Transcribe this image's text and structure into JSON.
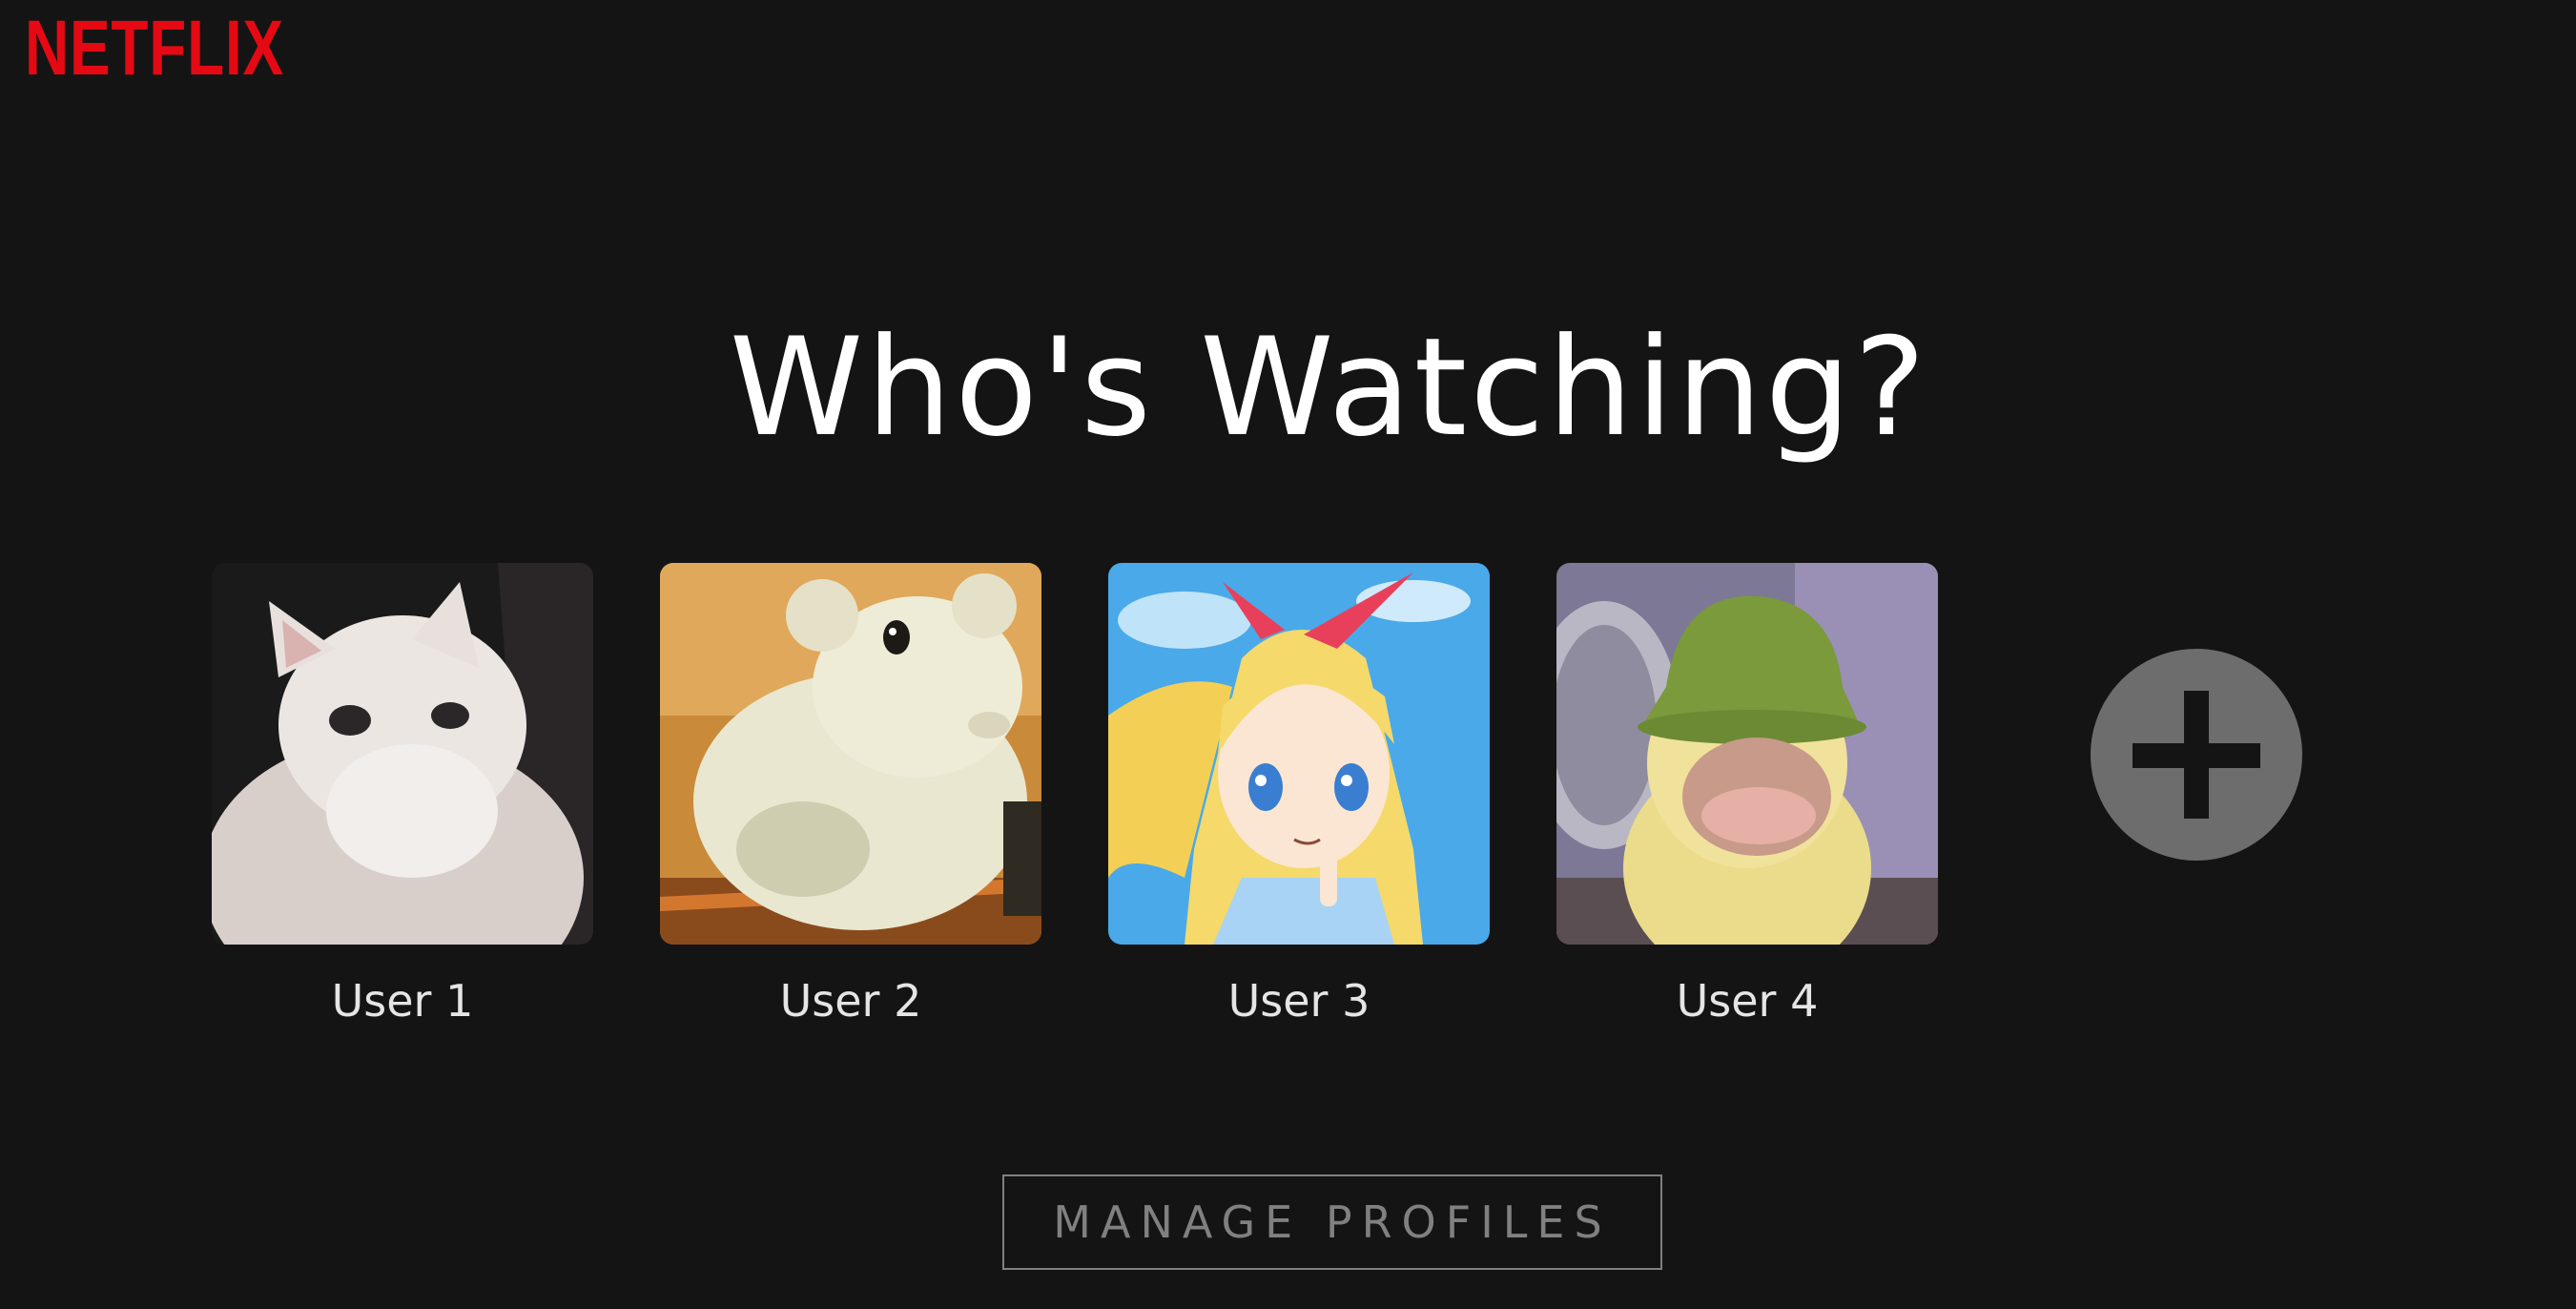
{
  "brand": {
    "logo_text": "NETFLIX",
    "logo_color": "#e50914"
  },
  "page": {
    "title": "Who's Watching?",
    "background": "#141414"
  },
  "profiles": [
    {
      "name": "User 1",
      "avatar": "white-cat-avatar"
    },
    {
      "name": "User 2",
      "avatar": "cartoon-hamster-avatar"
    },
    {
      "name": "User 3",
      "avatar": "anime-girl-avatar"
    },
    {
      "name": "User 4",
      "avatar": "duckling-bucket-hat-avatar"
    }
  ],
  "add_profile": {
    "icon": "plus-icon"
  },
  "manage_profiles": {
    "label": "MANAGE PROFILES"
  }
}
